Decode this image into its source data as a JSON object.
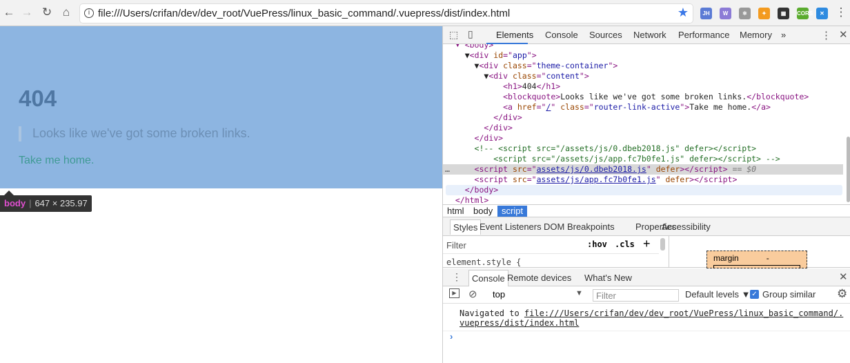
{
  "browser": {
    "url": "file:///Users/crifan/dev/dev_root/VuePress/linux_basic_command/.vuepress/dist/index.html",
    "extensions": [
      {
        "name": "jh-extension-icon",
        "label": "JH",
        "color": "#5b7bd5"
      },
      {
        "name": "wappalyzer-icon",
        "label": "W",
        "color": "#8c7bd6"
      },
      {
        "name": "react-devtools-icon",
        "label": "⚛",
        "color": "#999"
      },
      {
        "name": "orange-extension-icon",
        "label": "✦",
        "color": "#f39a1f"
      },
      {
        "name": "qr-code-icon",
        "label": "▦",
        "color": "#333"
      },
      {
        "name": "cors-icon",
        "label": "CORS",
        "color": "#5aab2e"
      },
      {
        "name": "blue-extension-icon",
        "label": "✕",
        "color": "#2e8be0"
      }
    ]
  },
  "page": {
    "heading": "404",
    "quote": "Looks like we've got some broken links.",
    "link": "Take me home."
  },
  "tooltip": {
    "tag": "body",
    "size": "647 × 235.97"
  },
  "devtools": {
    "tabs": [
      "Elements",
      "Console",
      "Sources",
      "Network",
      "Performance",
      "Memory",
      "»"
    ],
    "dom_lines": [
      {
        "indent": 1,
        "tokens": [
          [
            "t",
            "▾ <body>"
          ]
        ]
      },
      {
        "indent": 2,
        "tokens": [
          [
            "x",
            "▼"
          ],
          [
            "t",
            "<div "
          ],
          [
            "a",
            "id"
          ],
          [
            "t",
            "=\""
          ],
          [
            "v",
            "app"
          ],
          [
            "t",
            "\">"
          ]
        ]
      },
      {
        "indent": 3,
        "tokens": [
          [
            "x",
            "▼"
          ],
          [
            "t",
            "<div "
          ],
          [
            "a",
            "class"
          ],
          [
            "t",
            "=\""
          ],
          [
            "v",
            "theme-container"
          ],
          [
            "t",
            "\">"
          ]
        ]
      },
      {
        "indent": 4,
        "tokens": [
          [
            "x",
            "▼"
          ],
          [
            "t",
            "<div "
          ],
          [
            "a",
            "class"
          ],
          [
            "t",
            "=\""
          ],
          [
            "v",
            "content"
          ],
          [
            "t",
            "\">"
          ]
        ]
      },
      {
        "indent": 6,
        "tokens": [
          [
            "t",
            "<h1>"
          ],
          [
            "x",
            "404"
          ],
          [
            "t",
            "</h1>"
          ]
        ]
      },
      {
        "indent": 6,
        "tokens": [
          [
            "t",
            "<blockquote>"
          ],
          [
            "x",
            "Looks like we've got some broken links."
          ],
          [
            "t",
            "</blockquote>"
          ]
        ]
      },
      {
        "indent": 6,
        "tokens": [
          [
            "t",
            "<a "
          ],
          [
            "a",
            "href"
          ],
          [
            "t",
            "=\""
          ],
          [
            "l",
            "/"
          ],
          [
            "t",
            "\" "
          ],
          [
            "a",
            "class"
          ],
          [
            "t",
            "=\""
          ],
          [
            "v",
            "router-link-active"
          ],
          [
            "t",
            "\">"
          ],
          [
            "x",
            "Take me home."
          ],
          [
            "t",
            "</a>"
          ]
        ]
      },
      {
        "indent": 5,
        "tokens": [
          [
            "t",
            "</div>"
          ]
        ]
      },
      {
        "indent": 4,
        "tokens": [
          [
            "t",
            "</div>"
          ]
        ]
      },
      {
        "indent": 3,
        "tokens": [
          [
            "t",
            "</div>"
          ]
        ]
      },
      {
        "indent": 3,
        "tokens": [
          [
            "c",
            "<!-- <script src=\"/assets/js/0.dbeb2018.js\" defer></script>"
          ]
        ]
      },
      {
        "indent": 5,
        "tokens": [
          [
            "c",
            "<script src=\"/assets/js/app.fc7b0fe1.js\" defer></script> -->"
          ]
        ]
      },
      {
        "indent": 3,
        "sel": true,
        "tokens": [
          [
            "t",
            "<script "
          ],
          [
            "a",
            "src"
          ],
          [
            "t",
            "=\""
          ],
          [
            "l",
            "assets/js/0.dbeb2018.js"
          ],
          [
            "t",
            "\" "
          ],
          [
            "a",
            "defer"
          ],
          [
            "t",
            "></script>"
          ],
          [
            "g",
            " == $0"
          ]
        ]
      },
      {
        "indent": 3,
        "tokens": [
          [
            "t",
            "<script "
          ],
          [
            "a",
            "src"
          ],
          [
            "t",
            "=\""
          ],
          [
            "l",
            "assets/js/app.fc7b0fe1.js"
          ],
          [
            "t",
            "\" "
          ],
          [
            "a",
            "defer"
          ],
          [
            "t",
            "></script>"
          ]
        ]
      },
      {
        "indent": 2,
        "hov": true,
        "tokens": [
          [
            "t",
            "</body>"
          ]
        ]
      },
      {
        "indent": 1,
        "tokens": [
          [
            "t",
            "</html>"
          ]
        ]
      }
    ],
    "breadcrumbs": [
      "html",
      "body",
      "script"
    ],
    "styles_tabs": [
      "Styles",
      "Event Listeners",
      "DOM Breakpoints",
      "Properties",
      "Accessibility"
    ],
    "styles_filter": "Filter",
    "hov": ":hov",
    "cls": ".cls",
    "plus": "+",
    "element_style": "element.style {",
    "box_model": {
      "label": "margin",
      "value": "-"
    },
    "drawer_tabs": [
      "Console",
      "Remote devices",
      "What's New"
    ],
    "console": {
      "context": "top",
      "filter_placeholder": "Filter",
      "levels": "Default levels ▼",
      "group_similar": "Group similar",
      "group_checked": true,
      "message_prefix": "Navigated to ",
      "message_url": "file:///Users/crifan/dev/dev_root/VuePress/linux_basic_command/.vuepress/dist/index.html",
      "prompt": "›"
    }
  }
}
